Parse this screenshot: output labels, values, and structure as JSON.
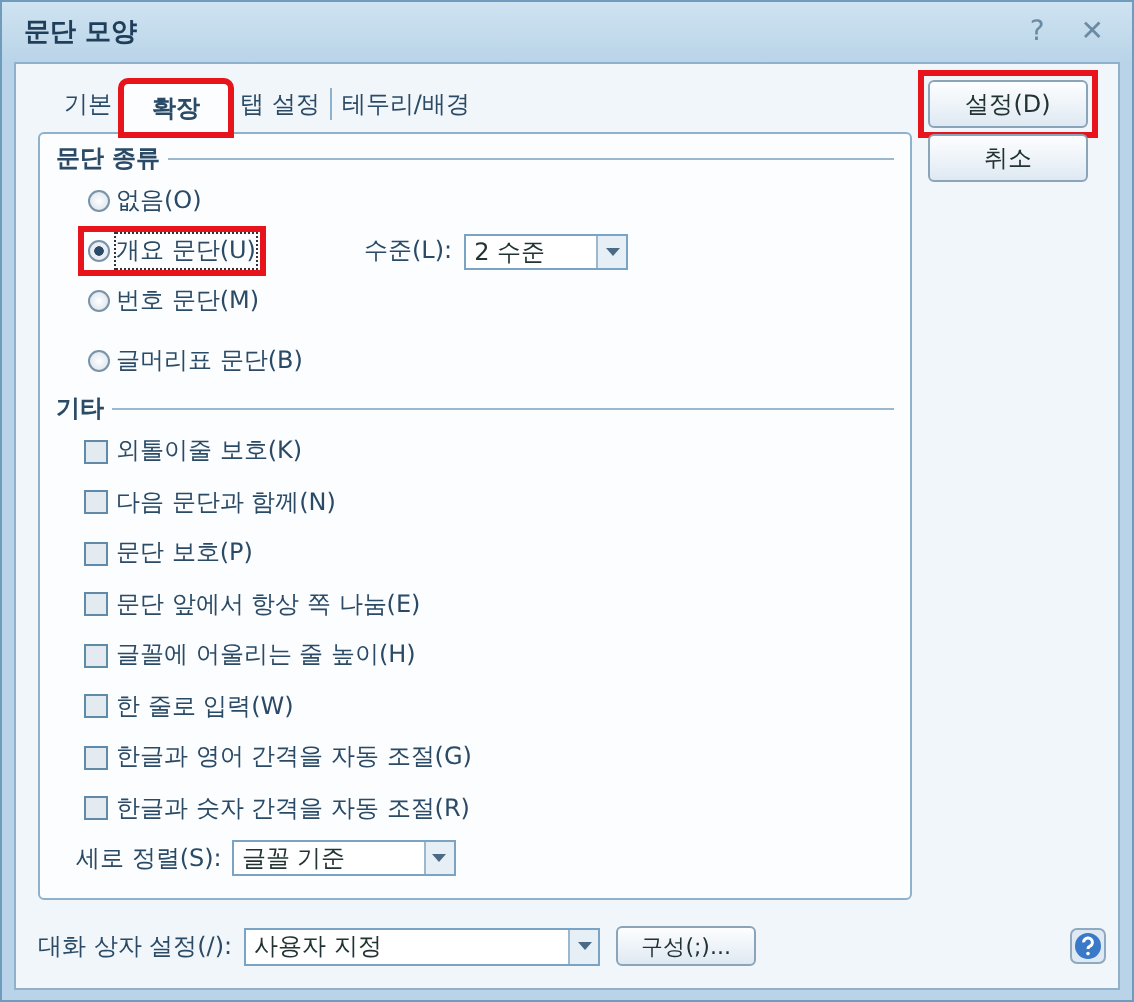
{
  "window": {
    "title": "문단 모양",
    "help_glyph": "?",
    "close_glyph": "✕"
  },
  "tabs": [
    {
      "label": "기본",
      "selected": false,
      "highlighted": false
    },
    {
      "label": "확장",
      "selected": true,
      "highlighted": true
    },
    {
      "label": "탭 설정",
      "selected": false,
      "highlighted": false
    },
    {
      "label": "테두리/배경",
      "selected": false,
      "highlighted": false
    }
  ],
  "paragraph_type": {
    "title": "문단 종류",
    "options": [
      {
        "label": "없음(O)",
        "selected": false,
        "highlighted": false
      },
      {
        "label": "개요 문단(U)",
        "selected": true,
        "highlighted": true
      },
      {
        "label": "번호 문단(M)",
        "selected": false,
        "highlighted": false
      },
      {
        "label": "글머리표 문단(B)",
        "selected": false,
        "highlighted": false
      }
    ],
    "level_label": "수준(L):",
    "level_value": "2 수준"
  },
  "other": {
    "title": "기타",
    "checkboxes": [
      {
        "label": "외톨이줄 보호(K)",
        "checked": false
      },
      {
        "label": "다음 문단과 함께(N)",
        "checked": false
      },
      {
        "label": "문단 보호(P)",
        "checked": false
      },
      {
        "label": "문단 앞에서 항상 쪽 나눔(E)",
        "checked": false
      },
      {
        "label": "글꼴에 어울리는 줄 높이(H)",
        "checked": false
      },
      {
        "label": "한 줄로 입력(W)",
        "checked": false
      },
      {
        "label": "한글과 영어 간격을 자동 조절(G)",
        "checked": false
      },
      {
        "label": "한글과 숫자 간격을 자동 조절(R)",
        "checked": false
      }
    ],
    "align_label": "세로 정렬(S):",
    "align_value": "글꼴 기준"
  },
  "buttons": [
    {
      "label": "설정(D)",
      "highlighted": true
    },
    {
      "label": "취소",
      "highlighted": false
    }
  ],
  "footer": {
    "label": "대화 상자 설정(/):",
    "value": "사용자 지정",
    "button": "구성(;)..."
  }
}
